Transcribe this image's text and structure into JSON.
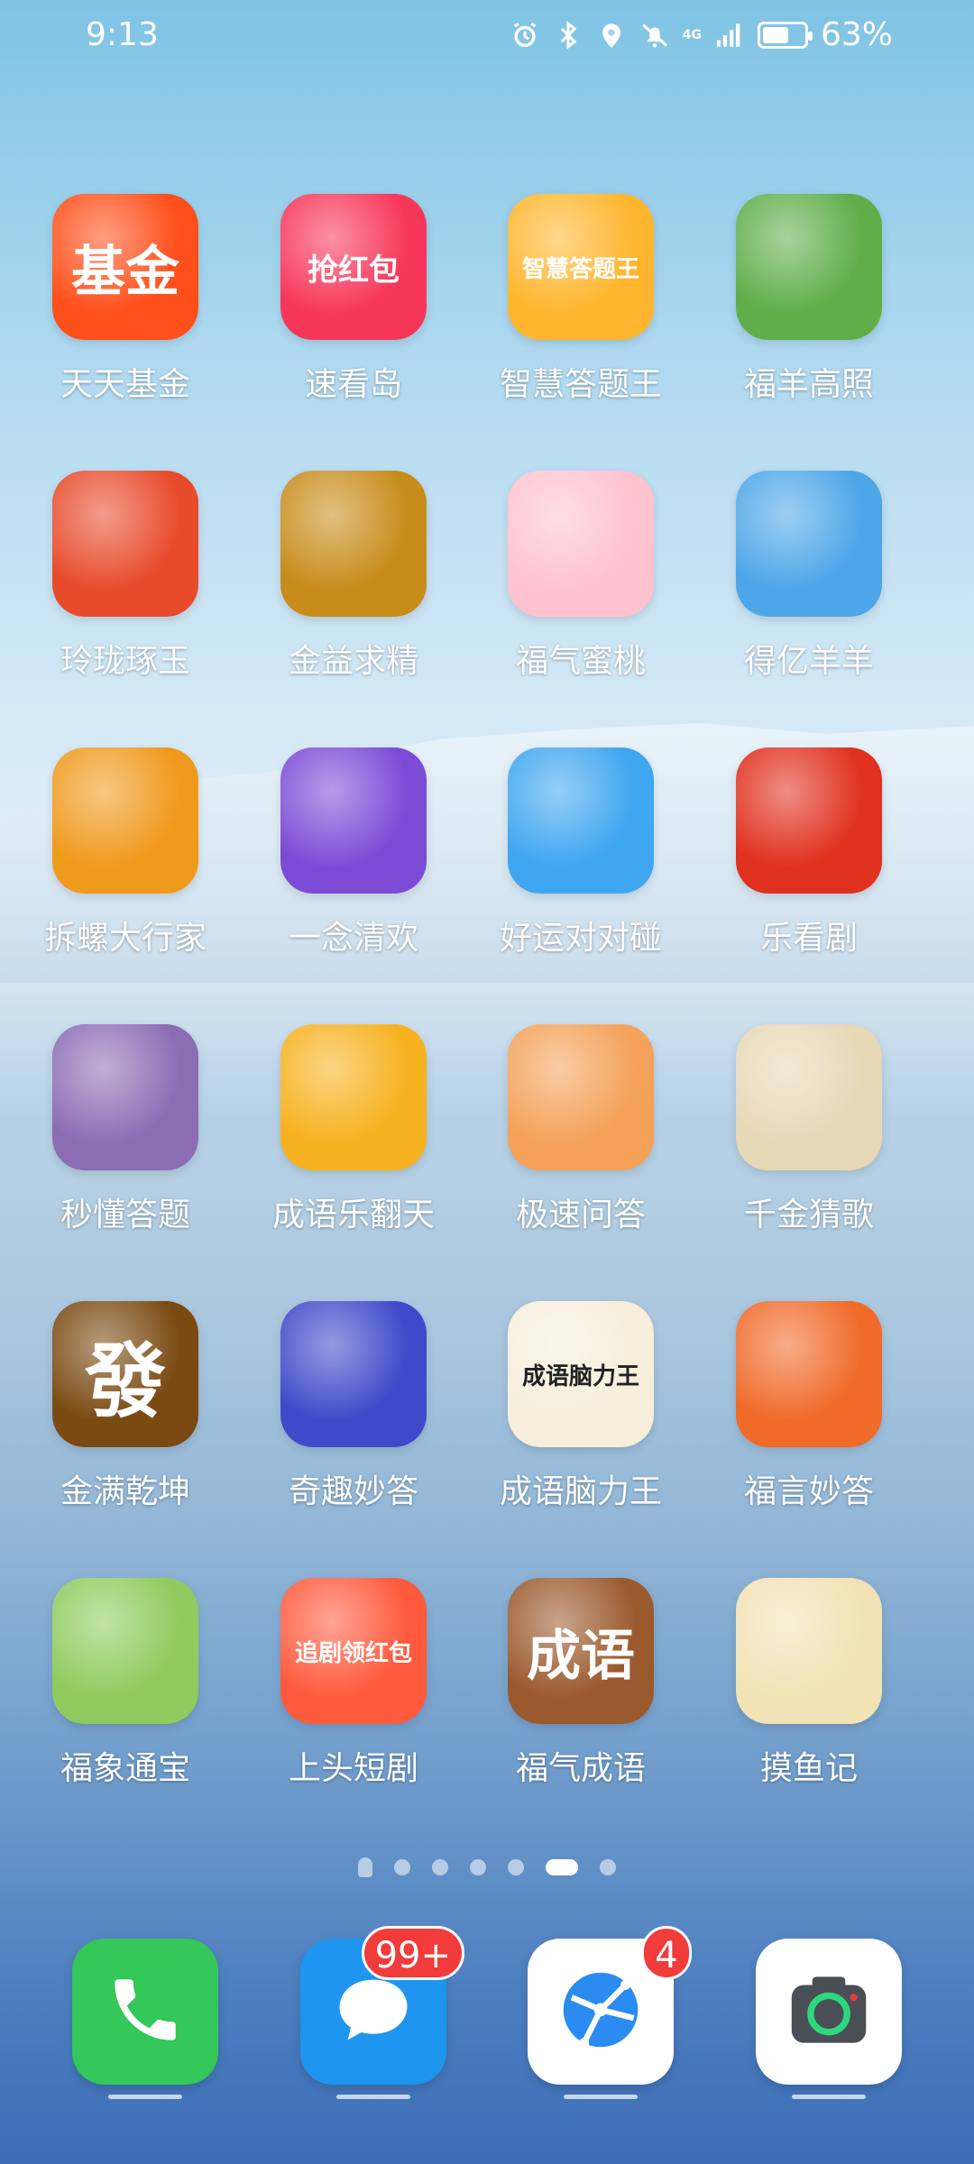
{
  "status_bar": {
    "time": "9:13",
    "network": "4G",
    "battery": "63%",
    "battery_level": 0.63
  },
  "apps": [
    {
      "label": "天天基金",
      "icon": "fund-icon",
      "color": "#ff4f1a",
      "glyph": "基金"
    },
    {
      "label": "速看岛",
      "icon": "video-redpacket-icon",
      "color": "#f7375a",
      "glyph": "抢红包"
    },
    {
      "label": "智慧答题王",
      "icon": "quiz-book-icon",
      "color": "#ffb62e",
      "glyph": "智慧答题王"
    },
    {
      "label": "福羊高照",
      "icon": "sheep-field-icon",
      "color": "#5fae4a",
      "glyph": ""
    },
    {
      "label": "玲珑琢玉",
      "icon": "god-of-wealth-icon",
      "color": "#e84b2c",
      "glyph": ""
    },
    {
      "label": "金益求精",
      "icon": "gold-man-icon",
      "color": "#c88c1b",
      "glyph": ""
    },
    {
      "label": "福气蜜桃",
      "icon": "peach-icon",
      "color": "#ffc3cf",
      "glyph": ""
    },
    {
      "label": "得亿羊羊",
      "icon": "sheep-icon",
      "color": "#4da6e8",
      "glyph": ""
    },
    {
      "label": "拆螺大行家",
      "icon": "screw-icon",
      "color": "#f09a1d",
      "glyph": ""
    },
    {
      "label": "一念清欢",
      "icon": "fruit-monkey-icon",
      "color": "#7c4bd6",
      "glyph": ""
    },
    {
      "label": "好运对对碰",
      "icon": "tofu-character-icon",
      "color": "#3fa6f0",
      "glyph": ""
    },
    {
      "label": "乐看剧",
      "icon": "clapperboard-icon",
      "color": "#e0301e",
      "glyph": ""
    },
    {
      "label": "秒懂答题",
      "icon": "girl-reading-icon",
      "color": "#8c6db4",
      "glyph": ""
    },
    {
      "label": "成语乐翻天",
      "icon": "scholar-icon",
      "color": "#f7b21f",
      "glyph": ""
    },
    {
      "label": "极速问答",
      "icon": "girl-glasses-icon",
      "color": "#f4a25a",
      "glyph": ""
    },
    {
      "label": "千金猜歌",
      "icon": "dancer-icon",
      "color": "#e7d8b6",
      "glyph": ""
    },
    {
      "label": "金满乾坤",
      "icon": "mahjong-tile-icon",
      "color": "#7a4a12",
      "glyph": "發"
    },
    {
      "label": "奇趣妙答",
      "icon": "boy-pencil-icon",
      "color": "#3f49c9",
      "glyph": ""
    },
    {
      "label": "成语脑力王",
      "icon": "idiom-brush-icon",
      "color": "#f7eedb",
      "glyph": "成语脑力王"
    },
    {
      "label": "福言妙答",
      "icon": "girl-lantern-icon",
      "color": "#f06a2a",
      "glyph": ""
    },
    {
      "label": "福象通宝",
      "icon": "lamb-icon",
      "color": "#8fcb5e",
      "glyph": ""
    },
    {
      "label": "上头短剧",
      "icon": "tv-redpacket-icon",
      "color": "#ff5a3d",
      "glyph": "追剧领红包"
    },
    {
      "label": "福气成语",
      "icon": "idiom-book-icon",
      "color": "#9b5a2e",
      "glyph": "成语"
    },
    {
      "label": "摸鱼记",
      "icon": "cat-office-icon",
      "color": "#f1e3b5",
      "glyph": ""
    }
  ],
  "pager": {
    "count": 7,
    "active": 6
  },
  "dock": [
    {
      "name": "phone",
      "icon": "phone-icon",
      "color": "#34c759",
      "badge": ""
    },
    {
      "name": "messages",
      "icon": "message-bubble-icon",
      "color": "#1e96f0",
      "badge": "99+"
    },
    {
      "name": "browser",
      "icon": "browser-icon",
      "color": "#ffffff",
      "badge": "4"
    },
    {
      "name": "camera",
      "icon": "camera-icon",
      "color": "#ffffff",
      "badge": ""
    }
  ]
}
